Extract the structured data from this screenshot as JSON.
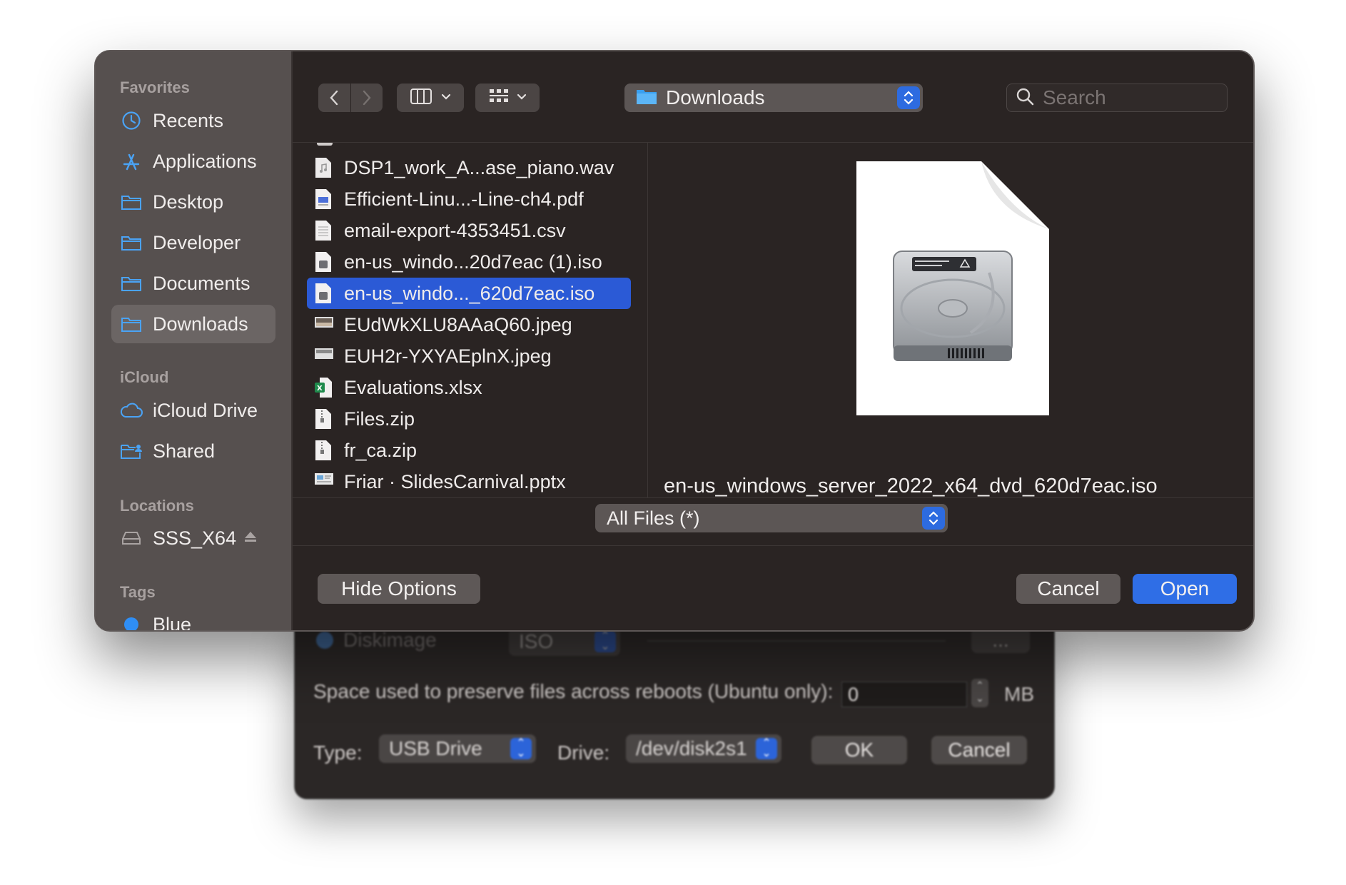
{
  "background_window": {
    "diskimage_label": "Diskimage",
    "diskimage_format": "ISO",
    "browse_label": "...",
    "persist_label": "Space used to preserve files across reboots (Ubuntu only):",
    "persist_value": "0",
    "persist_unit": "MB",
    "type_label": "Type:",
    "type_value": "USB Drive",
    "drive_label": "Drive:",
    "drive_value": "/dev/disk2s1",
    "ok_label": "OK",
    "cancel_label": "Cancel"
  },
  "sidebar": {
    "favorites_header": "Favorites",
    "favorites": [
      {
        "label": "Recents",
        "icon": "clock-icon"
      },
      {
        "label": "Applications",
        "icon": "applications-icon"
      },
      {
        "label": "Desktop",
        "icon": "folder-icon"
      },
      {
        "label": "Developer",
        "icon": "folder-icon"
      },
      {
        "label": "Documents",
        "icon": "folder-icon"
      },
      {
        "label": "Downloads",
        "icon": "folder-icon",
        "selected": true
      }
    ],
    "icloud_header": "iCloud",
    "icloud": [
      {
        "label": "iCloud Drive",
        "icon": "cloud-icon"
      },
      {
        "label": "Shared",
        "icon": "shared-folder-icon"
      }
    ],
    "locations_header": "Locations",
    "locations": [
      {
        "label": "SSS_X64",
        "icon": "drive-icon"
      }
    ],
    "tags_header": "Tags",
    "tags": [
      {
        "label": "Blue",
        "color": "#2f8ef5"
      }
    ]
  },
  "toolbar": {
    "location": "Downloads",
    "search_placeholder": "Search"
  },
  "files": [
    {
      "name": "DSP1_work_A...ase_piano.wav",
      "icon": "audio-file-icon"
    },
    {
      "name": "Efficient-Linu...-Line-ch4.pdf",
      "icon": "pdf-file-icon"
    },
    {
      "name": "email-export-4353451.csv",
      "icon": "csv-file-icon"
    },
    {
      "name": "en-us_windo...20d7eac (1).iso",
      "icon": "disk-image-file-icon"
    },
    {
      "name": "en-us_windo..._620d7eac.iso",
      "icon": "disk-image-file-icon",
      "selected": true
    },
    {
      "name": "EUdWkXLU8AAaQ60.jpeg",
      "icon": "image-file-icon"
    },
    {
      "name": "EUH2r-YXYAEplnX.jpeg",
      "icon": "image-file-icon"
    },
    {
      "name": "Evaluations.xlsx",
      "icon": "excel-file-icon"
    },
    {
      "name": "Files.zip",
      "icon": "zip-file-icon"
    },
    {
      "name": "fr_ca.zip",
      "icon": "zip-file-icon"
    },
    {
      "name": "Friar · SlidesCarnival.pptx",
      "icon": "presentation-file-icon"
    }
  ],
  "preview": {
    "filename": "en-us_windows_server_2022_x64_dvd_620d7eac.iso"
  },
  "filter": {
    "value": "All Files (*)"
  },
  "buttons": {
    "hide_options": "Hide Options",
    "cancel": "Cancel",
    "open": "Open"
  },
  "colors": {
    "accent_blue": "#2f6ee6",
    "selection_blue": "#2b5ad6",
    "sidebar_icon_blue": "#4aa3f5"
  }
}
